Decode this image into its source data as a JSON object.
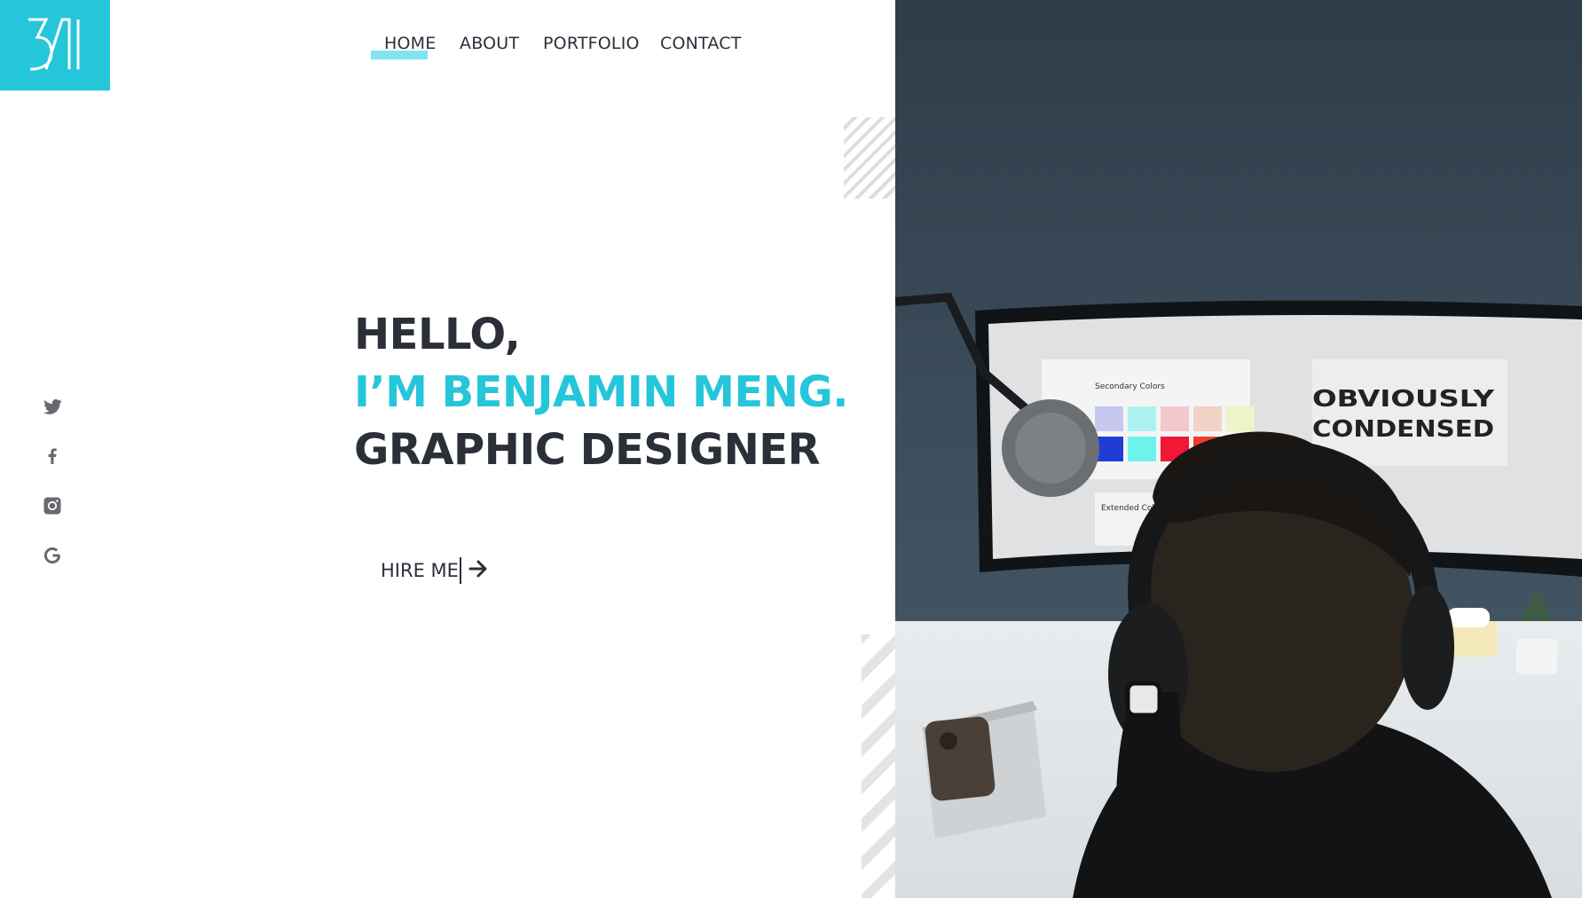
{
  "brand": {
    "logo_text": "BM",
    "accent_color": "#26c6da",
    "underline_color": "#80e5ef",
    "text_color": "#2b2f38"
  },
  "nav": {
    "items": [
      {
        "label": "HOME",
        "active": true
      },
      {
        "label": "ABOUT"
      },
      {
        "label": "PORTFOLIO"
      },
      {
        "label": "CONTACT"
      }
    ]
  },
  "hero": {
    "line1": "HELLO,",
    "line2": "I’M BENJAMIN MENG.",
    "line3": "GRAPHIC DESIGNER",
    "cta_label": "HIRE ME",
    "cta_icon": "arrow-right-icon"
  },
  "social": {
    "icons": [
      "twitter-icon",
      "facebook-icon",
      "instagram-icon",
      "google-icon"
    ]
  },
  "photo": {
    "screen_text_1": "OBVIOUSLY",
    "screen_text_2": "CONDENSED",
    "screen_label_a": "Secondary Colors",
    "screen_label_b": "Extended Colors"
  }
}
